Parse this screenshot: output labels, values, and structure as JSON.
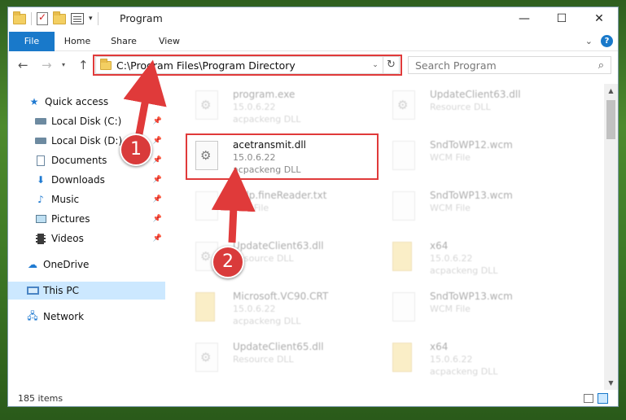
{
  "window": {
    "title": "Program",
    "controls": {
      "minimize": "—",
      "maximize": "☐",
      "close": "✕"
    }
  },
  "ribbon": {
    "tabs": [
      {
        "label": "File",
        "active": true
      },
      {
        "label": "Home"
      },
      {
        "label": "Share"
      },
      {
        "label": "View"
      }
    ],
    "help_glyph": "?"
  },
  "address_bar": {
    "path": "C:\\Program Files\\Program Directory",
    "search_placeholder": "Search Program"
  },
  "sidebar": {
    "items": [
      {
        "label": "Quick access",
        "icon": "star-icon"
      },
      {
        "label": "Local Disk (C:)",
        "icon": "disk-icon",
        "pinned": true
      },
      {
        "label": "Local Disk (D:)",
        "icon": "disk-icon",
        "pinned": true
      },
      {
        "label": "Documents",
        "icon": "documents-icon",
        "pinned": true
      },
      {
        "label": "Downloads",
        "icon": "downloads-icon",
        "pinned": true
      },
      {
        "label": "Music",
        "icon": "music-icon",
        "pinned": true
      },
      {
        "label": "Pictures",
        "icon": "pictures-icon",
        "pinned": true
      },
      {
        "label": "Videos",
        "icon": "videos-icon",
        "pinned": true
      },
      {
        "label": "OneDrive",
        "icon": "cloud-icon"
      },
      {
        "label": "This PC",
        "icon": "pc-icon",
        "selected": true
      },
      {
        "label": "Network",
        "icon": "network-icon"
      }
    ]
  },
  "files": [
    {
      "name": "program.exe",
      "line2": "15.0.6.22",
      "line3": "acpackeng DLL"
    },
    {
      "name": "UpdateClient63.dll",
      "line2": "Resource DLL",
      "line3": ""
    },
    {
      "name": "acetransmit.dll",
      "line2": "15.0.6.22",
      "line3": "acpackeng DLL",
      "highlighted": true
    },
    {
      "name": "SndToWP12.wcm",
      "line2": "WCM File",
      "line3": ""
    },
    {
      "name": "Help.fineReader.txt",
      "line2": "Text File",
      "line3": ""
    },
    {
      "name": "SndToWP13.wcm",
      "line2": "WCM File",
      "line3": ""
    },
    {
      "name": "UpdateClient63.dll",
      "line2": "Resource DLL",
      "line3": ""
    },
    {
      "name": "x64",
      "line2": "15.0.6.22",
      "line3": "acpackeng DLL"
    },
    {
      "name": "Microsoft.VC90.CRT",
      "line2": "15.0.6.22",
      "line3": "acpackeng DLL"
    },
    {
      "name": "SndToWP13.wcm",
      "line2": "WCM File",
      "line3": ""
    },
    {
      "name": "UpdateClient65.dll",
      "line2": "Resource DLL",
      "line3": ""
    },
    {
      "name": "x64",
      "line2": "15.0.6.22",
      "line3": "acpackeng DLL"
    }
  ],
  "status": {
    "item_count": "185 items"
  },
  "annotations": {
    "step1": "1",
    "step2": "2"
  },
  "colors": {
    "accent": "#1979ca",
    "highlight": "#e03a3a",
    "selected_bg": "#cce8ff"
  }
}
